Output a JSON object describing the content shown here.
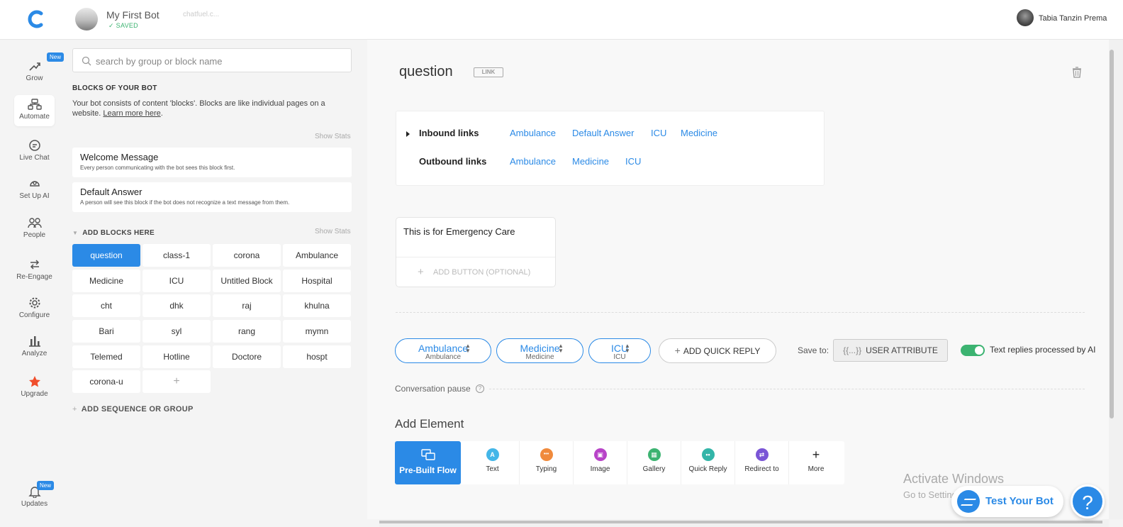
{
  "app": {
    "logo_icon": "chatfuel-logo-icon",
    "brand_color": "#2b8ae6",
    "bot_name": "My First Bot",
    "bot_status": "✓ SAVED",
    "bot_link": "chatfuel.c...",
    "user_name": "Tabia Tanzin Prema"
  },
  "nav": [
    {
      "label": "Grow",
      "icon": "grow-icon",
      "badge": "New"
    },
    {
      "label": "Automate",
      "icon": "automate-icon"
    },
    {
      "label": "Live Chat",
      "icon": "chat-icon"
    },
    {
      "label": "Set Up AI",
      "icon": "ai-icon"
    },
    {
      "label": "People",
      "icon": "people-icon"
    },
    {
      "label": "Re-Engage",
      "icon": "reengage-icon"
    },
    {
      "label": "Configure",
      "icon": "gear-icon"
    },
    {
      "label": "Analyze",
      "icon": "chart-icon"
    },
    {
      "label": "Upgrade",
      "icon": "star-icon"
    },
    {
      "label": "Updates",
      "icon": "bell-icon",
      "badge": "New"
    }
  ],
  "sidebar": {
    "search_placeholder": "search by group or block name",
    "blocks_title": "BLOCKS OF YOUR BOT",
    "blocks_desc": "Your bot consists of content 'blocks'. Blocks are like individual pages on a website.",
    "learn_more": "Learn more here",
    "show_stats": "Show Stats",
    "system_blocks": [
      {
        "title": "Welcome Message",
        "desc": "Every person communicating with the bot sees this block first."
      },
      {
        "title": "Default Answer",
        "desc": "A person will see this block if the bot does not recognize a text message from them."
      }
    ],
    "add_blocks_title": "ADD BLOCKS HERE",
    "blocks": [
      "question",
      "class-1",
      "corona",
      "Ambulance",
      "Medicine",
      "ICU",
      "Untitled Block",
      "Hospital",
      "cht",
      "dhk",
      "raj",
      "khulna",
      "Bari",
      "syl",
      "rang",
      "mymn",
      "Telemed",
      "Hotline",
      "Doctore",
      "hospt",
      "corona-u"
    ],
    "active_block": "question",
    "add_plus": "+",
    "add_sequence": "ADD SEQUENCE OR GROUP"
  },
  "editor": {
    "title": "question",
    "link_badge": "LINK",
    "inbound_label": "Inbound links",
    "inbound": [
      "Ambulance",
      "Default Answer",
      "ICU",
      "Medicine"
    ],
    "outbound_label": "Outbound links",
    "outbound": [
      "Ambulance",
      "Medicine",
      "ICU"
    ],
    "text_card": "This is for Emergency Care",
    "add_button": "ADD BUTTON (OPTIONAL)",
    "quick_replies": [
      {
        "title": "Ambulance",
        "sub": "Ambulance"
      },
      {
        "title": "Medicine",
        "sub": "Medicine"
      },
      {
        "title": "ICU",
        "sub": "ICU"
      }
    ],
    "add_quick_reply": "ADD QUICK REPLY",
    "save_to": "Save to:",
    "user_attribute_prefix": "{{...}}",
    "user_attribute": "USER ATTRIBUTE",
    "ai_toggle_on": true,
    "ai_toggle_label": "Text replies processed by AI",
    "conversation_pause": "Conversation pause",
    "add_element_title": "Add Element",
    "elements": [
      {
        "label": "Pre-Built Flow",
        "icon": "flow-icon"
      },
      {
        "label": "Text",
        "icon": "text-icon",
        "color": "#44b6e8",
        "glyph": "A"
      },
      {
        "label": "Typing",
        "icon": "typing-icon",
        "color": "#f08a3c",
        "glyph": "•••"
      },
      {
        "label": "Image",
        "icon": "image-icon",
        "color": "#b844c8",
        "glyph": "▣"
      },
      {
        "label": "Gallery",
        "icon": "gallery-icon",
        "color": "#3cb371",
        "glyph": "▦"
      },
      {
        "label": "Quick Reply",
        "icon": "quick-reply-icon",
        "color": "#33b5a8",
        "glyph": "••"
      },
      {
        "label": "Redirect to",
        "icon": "redirect-icon",
        "color": "#7a55d6",
        "glyph": "⇄"
      },
      {
        "label": "More",
        "icon": "plus-icon",
        "glyph": "+"
      }
    ]
  },
  "overlay": {
    "win_title": "Activate Windows",
    "win_sub": "Go to Settings to activate Windows.",
    "test_bot": "Test Your Bot",
    "help": "?"
  }
}
